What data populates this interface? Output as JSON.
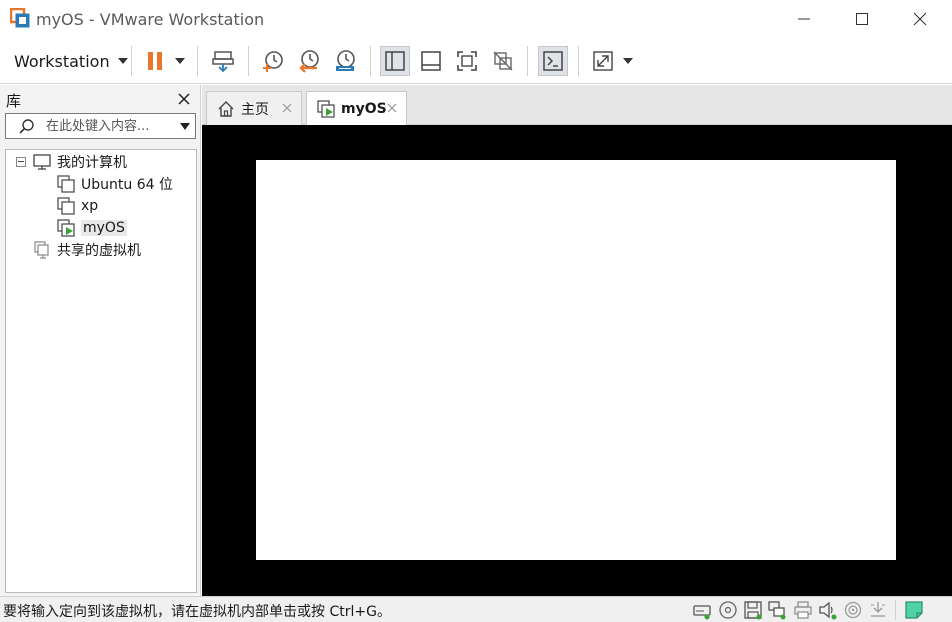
{
  "window": {
    "title": "myOS - VMware Workstation"
  },
  "toolbar": {
    "menu_label": "Workstation"
  },
  "library": {
    "title": "库",
    "search_placeholder": "在此处键入内容...",
    "tree": {
      "root_label": "我的计算机",
      "vms": [
        {
          "label": "Ubuntu 64 位"
        },
        {
          "label": "xp"
        },
        {
          "label": "myOS"
        }
      ],
      "shared_label": "共享的虚拟机"
    }
  },
  "tabs": [
    {
      "label": "主页"
    },
    {
      "label": "myOS"
    }
  ],
  "status": {
    "message": "要将输入定向到该虚拟机，请在虚拟机内部单击或按 Ctrl+G。"
  },
  "colors": {
    "accent_orange": "#e8762c",
    "accent_green": "#3aa335",
    "accent_blue": "#2a7ab8",
    "vm_background": "#000000"
  }
}
